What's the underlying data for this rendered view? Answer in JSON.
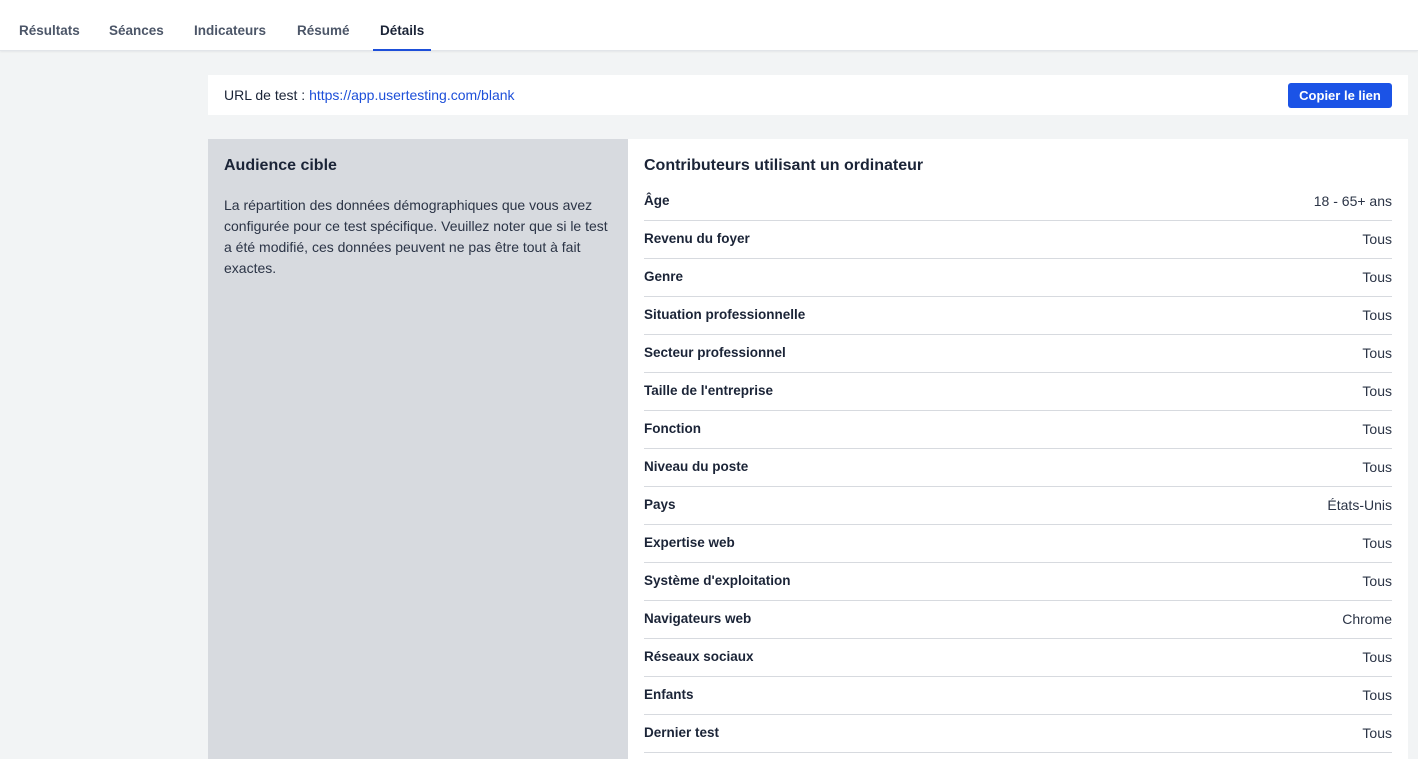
{
  "tabs": [
    {
      "label": "Résultats",
      "active": false
    },
    {
      "label": "Séances",
      "active": false
    },
    {
      "label": "Indicateurs",
      "active": false
    },
    {
      "label": "Résumé",
      "active": false
    },
    {
      "label": "Détails",
      "active": true
    }
  ],
  "url_bar": {
    "label": "URL de test : ",
    "url": "https://app.usertesting.com/blank",
    "copy_button": "Copier le lien"
  },
  "audience": {
    "title": "Audience cible",
    "description": "La répartition des données démographiques que vous avez configurée pour ce test spécifique. Veuillez noter que si le test a été modifié, ces données peuvent ne pas être tout à fait exactes."
  },
  "contributors": {
    "title": "Contributeurs utilisant un ordinateur",
    "rows": [
      {
        "label": "Âge",
        "value": "18 - 65+ ans"
      },
      {
        "label": "Revenu du foyer",
        "value": "Tous"
      },
      {
        "label": "Genre",
        "value": "Tous"
      },
      {
        "label": "Situation professionnelle",
        "value": "Tous"
      },
      {
        "label": "Secteur professionnel",
        "value": "Tous"
      },
      {
        "label": "Taille de l'entreprise",
        "value": "Tous"
      },
      {
        "label": "Fonction",
        "value": "Tous"
      },
      {
        "label": "Niveau du poste",
        "value": "Tous"
      },
      {
        "label": "Pays",
        "value": "États-Unis"
      },
      {
        "label": "Expertise web",
        "value": "Tous"
      },
      {
        "label": "Système d'exploitation",
        "value": "Tous"
      },
      {
        "label": "Navigateurs web",
        "value": "Chrome"
      },
      {
        "label": "Réseaux sociaux",
        "value": "Tous"
      },
      {
        "label": "Enfants",
        "value": "Tous"
      },
      {
        "label": "Dernier test",
        "value": "Tous"
      }
    ]
  },
  "colors": {
    "accent": "#1b53e6",
    "link": "#1d4fd9",
    "audience_bg": "#d7dadf",
    "page_bg": "#f2f4f5"
  }
}
